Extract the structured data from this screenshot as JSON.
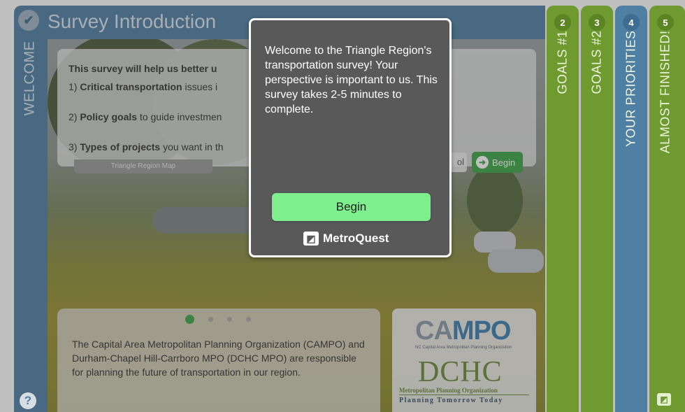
{
  "header": {
    "title": "Survey Introduction"
  },
  "sidebar": {
    "welcome_label": "WELCOME",
    "help_symbol": "?"
  },
  "intro_card": {
    "heading": "This survey will help us better u",
    "item1_prefix": "1) ",
    "item1_bold": "Critical transportation",
    "item1_rest": " issues i",
    "item2_prefix": "2) ",
    "item2_bold": "Policy goals",
    "item2_rest": " to guide investmen",
    "item3_prefix": "3) ",
    "item3_bold": "Types of projects",
    "item3_rest": " you want in th",
    "map_tab_label": "Triangle Region Map",
    "tool_label": "ol",
    "begin_label": "Begin"
  },
  "bottom_card": {
    "text": "The Capital Area Metropolitan Planning Organization (CAMPO) and Durham-Chapel Hill-Carrboro MPO (DCHC MPO) are responsible for planning the future of transportation in our region.",
    "dots": 4,
    "active_dot": 0
  },
  "logos": {
    "campo_part1": "CA",
    "campo_part2": "MPO",
    "campo_sub": "NC Capital Area Metropolitan Planning Organization",
    "dchc": "DCHC",
    "dchc_sub1": "Metropolitan Planning Organization",
    "dchc_sub2": "Planning Tomorrow Today"
  },
  "steps": [
    {
      "number": "2",
      "label": "GOALS #1",
      "color": "#6f9a2f",
      "num_color": "#5b8423"
    },
    {
      "number": "3",
      "label": "GOALS #2",
      "color": "#6f9a2f",
      "num_color": "#5b8423"
    },
    {
      "number": "4",
      "label": "YOUR PRIORITIES",
      "color": "#4f7fa3",
      "num_color": "#3f6d90"
    },
    {
      "number": "5",
      "label": "ALMOST FINISHED!",
      "color": "#6f9a2f",
      "num_color": "#5b8423"
    }
  ],
  "modal": {
    "message": "Welcome to the Triangle Region's transportation survey! Your perspective is important to us. This survey takes 2-5 minutes to complete.",
    "begin_label": "Begin",
    "brand": "MetroQuest"
  },
  "colors": {
    "accent_green": "#3da447",
    "modal_button": "#7df08d",
    "welcome_blue": "#4f7fa3"
  }
}
